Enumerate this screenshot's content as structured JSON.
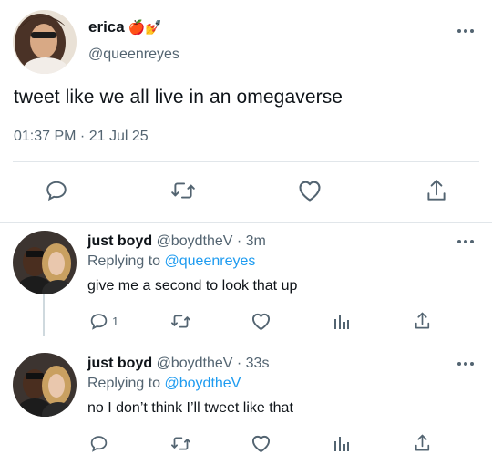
{
  "main_tweet": {
    "display_name": "erica",
    "name_emojis": "🍎💅",
    "handle": "@queenreyes",
    "text": "tweet like we all live in an omegaverse",
    "timestamp": "01:37 PM · 21 Jul 25"
  },
  "replies": [
    {
      "display_name": "just boyd",
      "handle": "@boydtheV",
      "time": "· 3m",
      "replying_prefix": "Replying to",
      "replying_to": "@queenreyes",
      "text": "give me a second to look that up",
      "reply_count": "1"
    },
    {
      "display_name": "just boyd",
      "handle": "@boydtheV",
      "time": "· 33s",
      "replying_prefix": "Replying to",
      "replying_to": "@boydtheV",
      "text": "no I don’t think I’ll tweet like that",
      "reply_count": ""
    }
  ],
  "colors": {
    "icon_gray": "#536471",
    "link_blue": "#1d9bf0",
    "divider": "#e1e6ea"
  },
  "icons": [
    "reply-icon",
    "retweet-icon",
    "like-icon",
    "analytics-icon",
    "share-icon",
    "more-icon"
  ]
}
